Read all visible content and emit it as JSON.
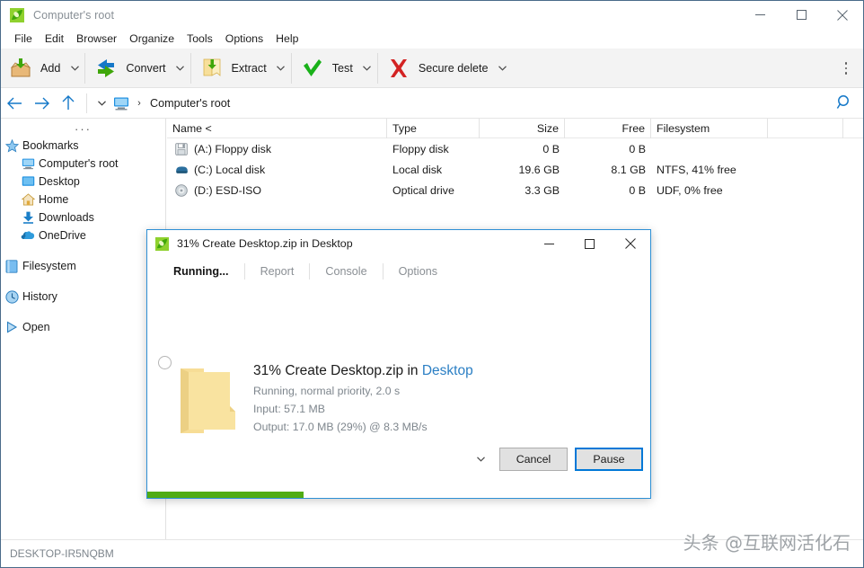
{
  "window": {
    "title": "Computer's root",
    "app_icon": "peazip-icon",
    "controls": {
      "minimize": "minimize-icon",
      "maximize": "maximize-icon",
      "close": "close-icon"
    }
  },
  "menubar": {
    "items": [
      "File",
      "Edit",
      "Browser",
      "Organize",
      "Tools",
      "Options",
      "Help"
    ]
  },
  "toolbar": {
    "buttons": [
      {
        "label": "Add",
        "icon": "add-archive-icon",
        "caret": true
      },
      {
        "label": "Convert",
        "icon": "convert-icon",
        "caret": true
      },
      {
        "label": "Extract",
        "icon": "extract-folder-icon",
        "caret": true
      },
      {
        "label": "Test",
        "icon": "test-check-icon",
        "caret": true
      },
      {
        "label": "Secure delete",
        "icon": "secure-delete-x-icon",
        "caret": true
      }
    ],
    "overflow_icon": "kebab-menu-icon"
  },
  "navbar": {
    "back_icon": "back-arrow-icon",
    "forward_icon": "forward-arrow-icon",
    "up_icon": "up-arrow-icon",
    "history_caret_icon": "chevron-down-icon",
    "root_icon": "computer-icon",
    "separator_chevron": "›",
    "path": "Computer's root",
    "search_icon": "search-icon"
  },
  "sidebar": {
    "overflow_dots": "···",
    "groups": [
      {
        "items": [
          {
            "label": "Bookmarks",
            "icon": "star-icon",
            "indent": false
          },
          {
            "label": "Computer's root",
            "icon": "computer-icon",
            "indent": true
          },
          {
            "label": "Desktop",
            "icon": "desktop-icon",
            "indent": true
          },
          {
            "label": "Home",
            "icon": "home-icon",
            "indent": true
          },
          {
            "label": "Downloads",
            "icon": "download-icon",
            "indent": true
          },
          {
            "label": "OneDrive",
            "icon": "cloud-icon",
            "indent": true
          }
        ]
      },
      {
        "items": [
          {
            "label": "Filesystem",
            "icon": "filesystem-icon",
            "indent": false
          }
        ]
      },
      {
        "items": [
          {
            "label": "History",
            "icon": "clock-icon",
            "indent": false
          }
        ]
      },
      {
        "items": [
          {
            "label": "Open",
            "icon": "play-triangle-icon",
            "indent": false
          }
        ]
      }
    ]
  },
  "filelist": {
    "columns": [
      "Name <",
      "Type",
      "Size",
      "Free",
      "Filesystem",
      ""
    ],
    "rows": [
      {
        "icon": "floppy-disk-icon",
        "name": "(A:) Floppy disk",
        "type": "Floppy disk",
        "size": "0 B",
        "free": "0 B",
        "filesystem": ""
      },
      {
        "icon": "hard-disk-icon",
        "name": "(C:) Local disk",
        "type": "Local disk",
        "size": "19.6 GB",
        "free": "8.1 GB",
        "filesystem": "NTFS, 41% free"
      },
      {
        "icon": "optical-disc-icon",
        "name": "(D:) ESD-ISO",
        "type": "Optical drive",
        "size": "3.3 GB",
        "free": "0 B",
        "filesystem": "UDF, 0% free"
      }
    ]
  },
  "statusbar": {
    "text": "DESKTOP-IR5NQBM"
  },
  "watermark": {
    "text": "头条 @互联网活化石"
  },
  "dialog": {
    "icon": "peazip-icon",
    "title": "31% Create Desktop.zip in Desktop",
    "controls": {
      "minimize": "minimize-icon",
      "maximize": "maximize-icon",
      "close": "close-icon"
    },
    "tabs": [
      {
        "label": "Running...",
        "active": true
      },
      {
        "label": "Report",
        "active": false
      },
      {
        "label": "Console",
        "active": false
      },
      {
        "label": "Options",
        "active": false
      }
    ],
    "spinner_icon": "spinner-icon",
    "folder_icon": "folder-icon",
    "headline_prefix": "31% Create Desktop.zip in ",
    "headline_destination": "Desktop",
    "status_line": "Running, normal priority, 2.0 s",
    "input_line": "Input: 57.1 MB",
    "output_line": "Output: 17.0 MB (29%) @ 8.3 MB/s",
    "more_caret_icon": "chevron-down-icon",
    "cancel_label": "Cancel",
    "pause_label": "Pause",
    "progress_percent": 31,
    "progress_color": "#50ac14"
  }
}
